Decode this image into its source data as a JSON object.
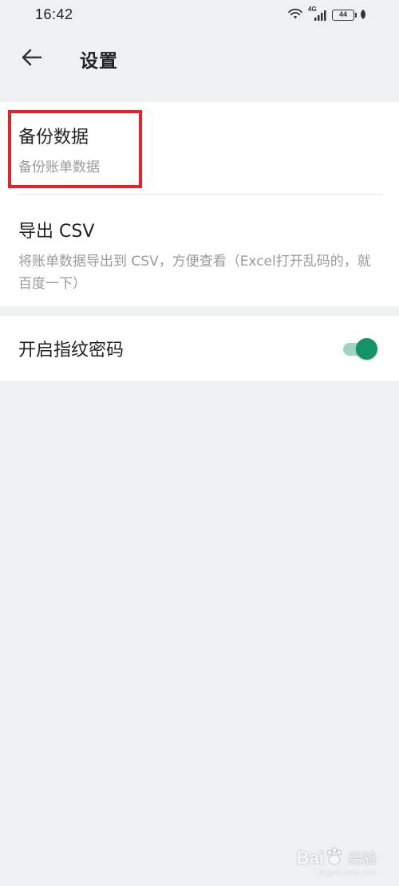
{
  "status_bar": {
    "time": "16:42",
    "network": "4G",
    "battery": "44"
  },
  "app_bar": {
    "title": "设置"
  },
  "settings": {
    "backup": {
      "title": "备份数据",
      "subtitle": "备份账单数据"
    },
    "export": {
      "title": "导出 CSV",
      "subtitle": "将账单数据导出到 CSV，方便查看（Excel打开乱码的，就百度一下）"
    },
    "fingerprint": {
      "label": "开启指纹密码",
      "enabled": true
    }
  },
  "watermark": {
    "brand": "Bai",
    "brand_suffix": "经验",
    "url": "jingyan.baidu.com"
  },
  "colors": {
    "highlight": "#e8202a",
    "toggle_on": "#12936a",
    "background": "#eef0f3"
  },
  "icons": [
    "back-arrow-icon",
    "wifi-icon",
    "signal-icon",
    "battery-icon",
    "leaf-icon"
  ]
}
